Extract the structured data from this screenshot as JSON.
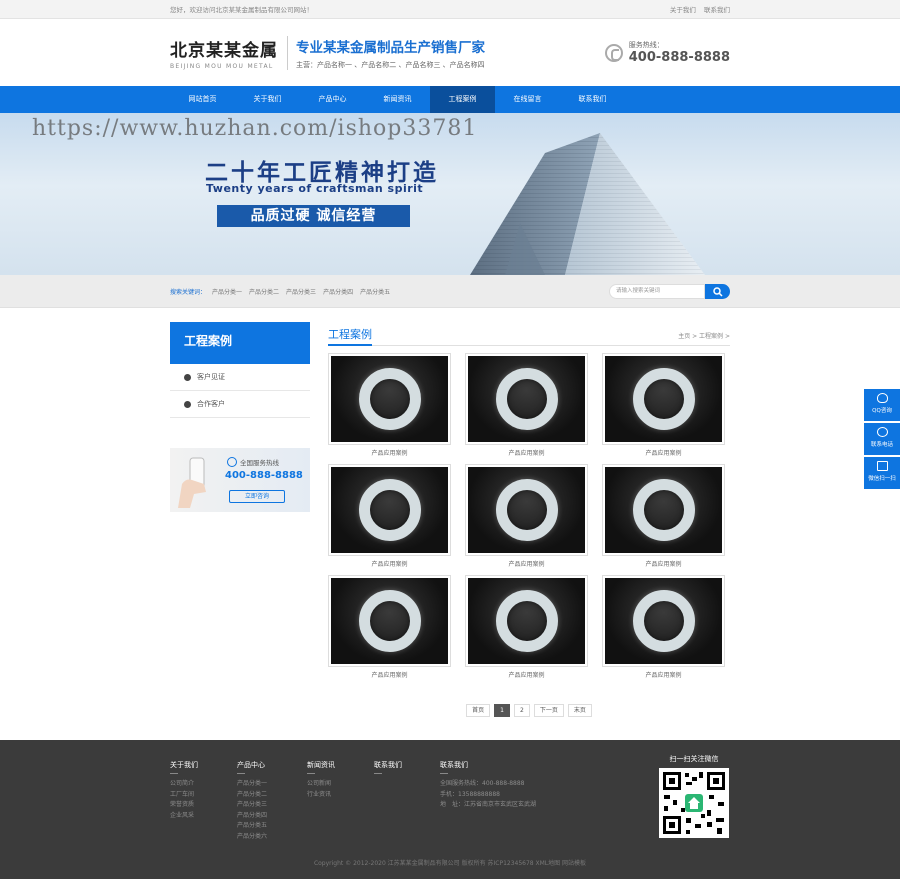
{
  "topbar": {
    "welcome": "您好，欢迎访问北京某某金属制品有限公司网站！",
    "links": [
      "关于我们",
      "联系我们"
    ]
  },
  "header": {
    "logo_cn": "北京某某金属",
    "logo_en": "BEIJING MOU MOU METAL",
    "slogan": "专业某某金属制品生产销售厂家",
    "main_products": "主营：产品名称一 、产品名称二 、产品名称三 、产品名称四",
    "hotline_label": "服务热线：",
    "hotline_number": "400-888-8888"
  },
  "nav": {
    "items": [
      "网站首页",
      "关于我们",
      "产品中心",
      "新闻资讯",
      "工程案例",
      "在线留言",
      "联系我们"
    ],
    "active_index": 4
  },
  "banner": {
    "watermark": "https://www.huzhan.com/ishop33781",
    "headline": "二十年工匠精神打造",
    "english": "Twenty years of craftsman spirit",
    "tagline": "品质过硬  诚信经营"
  },
  "search": {
    "keywords_label": "搜索关键词：",
    "keywords": [
      "产品分类一",
      "产品分类二",
      "产品分类三",
      "产品分类四",
      "产品分类五"
    ],
    "placeholder": "请输入搜索关键词"
  },
  "sidebar": {
    "title": "工程案例",
    "items": [
      "客户见证",
      "合作客户"
    ],
    "contact_label": "全国服务热线",
    "contact_number": "400-888-8888",
    "contact_button": "立即咨询"
  },
  "main": {
    "title": "工程案例",
    "breadcrumb": "主页 > 工程案例 >",
    "cards": [
      "产品应用案例",
      "产品应用案例",
      "产品应用案例",
      "产品应用案例",
      "产品应用案例",
      "产品应用案例",
      "产品应用案例",
      "产品应用案例",
      "产品应用案例"
    ],
    "pager": [
      "首页",
      "1",
      "2",
      "下一页",
      "末页"
    ]
  },
  "float": [
    "QQ咨询",
    "联系电话",
    "微信扫一扫"
  ],
  "footer": {
    "about": {
      "title": "关于我们",
      "links": [
        "公司简介",
        "工厂车间",
        "荣誉资质",
        "企业风采"
      ]
    },
    "products": {
      "title": "产品中心",
      "links": [
        "产品分类一",
        "产品分类二",
        "产品分类三",
        "产品分类四",
        "产品分类五",
        "产品分类六"
      ]
    },
    "news": {
      "title": "新闻资讯",
      "links": [
        "公司新闻",
        "行业资讯"
      ]
    },
    "contact_nav": {
      "title": "联系我们",
      "links": []
    },
    "contact": {
      "title": "联系我们",
      "lines": [
        "全国服务热线：400-888-8888",
        "手机：13588888888",
        "地　址：江苏省南京市玄武区玄武湖"
      ]
    },
    "qr_title": "扫一扫关注微信",
    "copyright": "Copyright © 2012-2020 江苏某某金属制品有限公司 版权所有  苏ICP12345678  XML地图  网站模板"
  },
  "colors": {
    "accent": "#0e75e0",
    "nav_active": "#0a4f9c",
    "footer_bg": "#3b3b3b"
  }
}
